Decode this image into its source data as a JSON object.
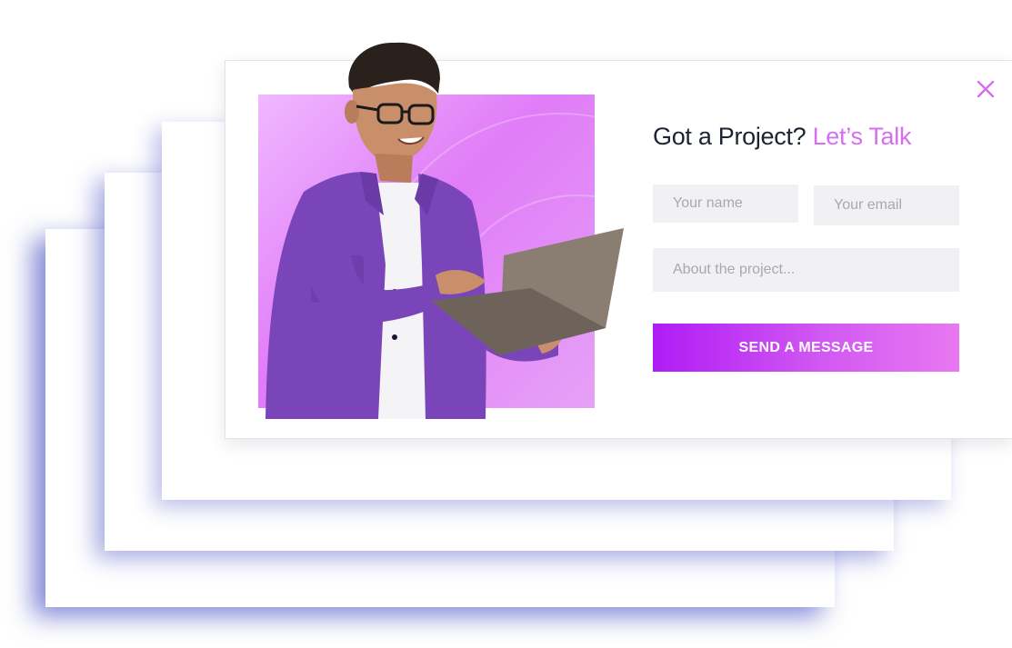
{
  "popup": {
    "title_main": "Got a Project?",
    "title_accent": "Let’s Talk",
    "form": {
      "name_placeholder": "Your name",
      "email_placeholder": "Your email",
      "about_placeholder": "About the project...",
      "submit_label": "SEND A MESSAGE"
    },
    "icons": {
      "close": "close-icon"
    }
  },
  "colors": {
    "accent": "#d56ff0",
    "button_start": "#b01cf5",
    "button_end": "#e878f0",
    "title": "#1d2433",
    "field_bg": "#f1f1f3",
    "shadow_blue": "#1e28b4",
    "photo_bg": "#e07cf7"
  }
}
